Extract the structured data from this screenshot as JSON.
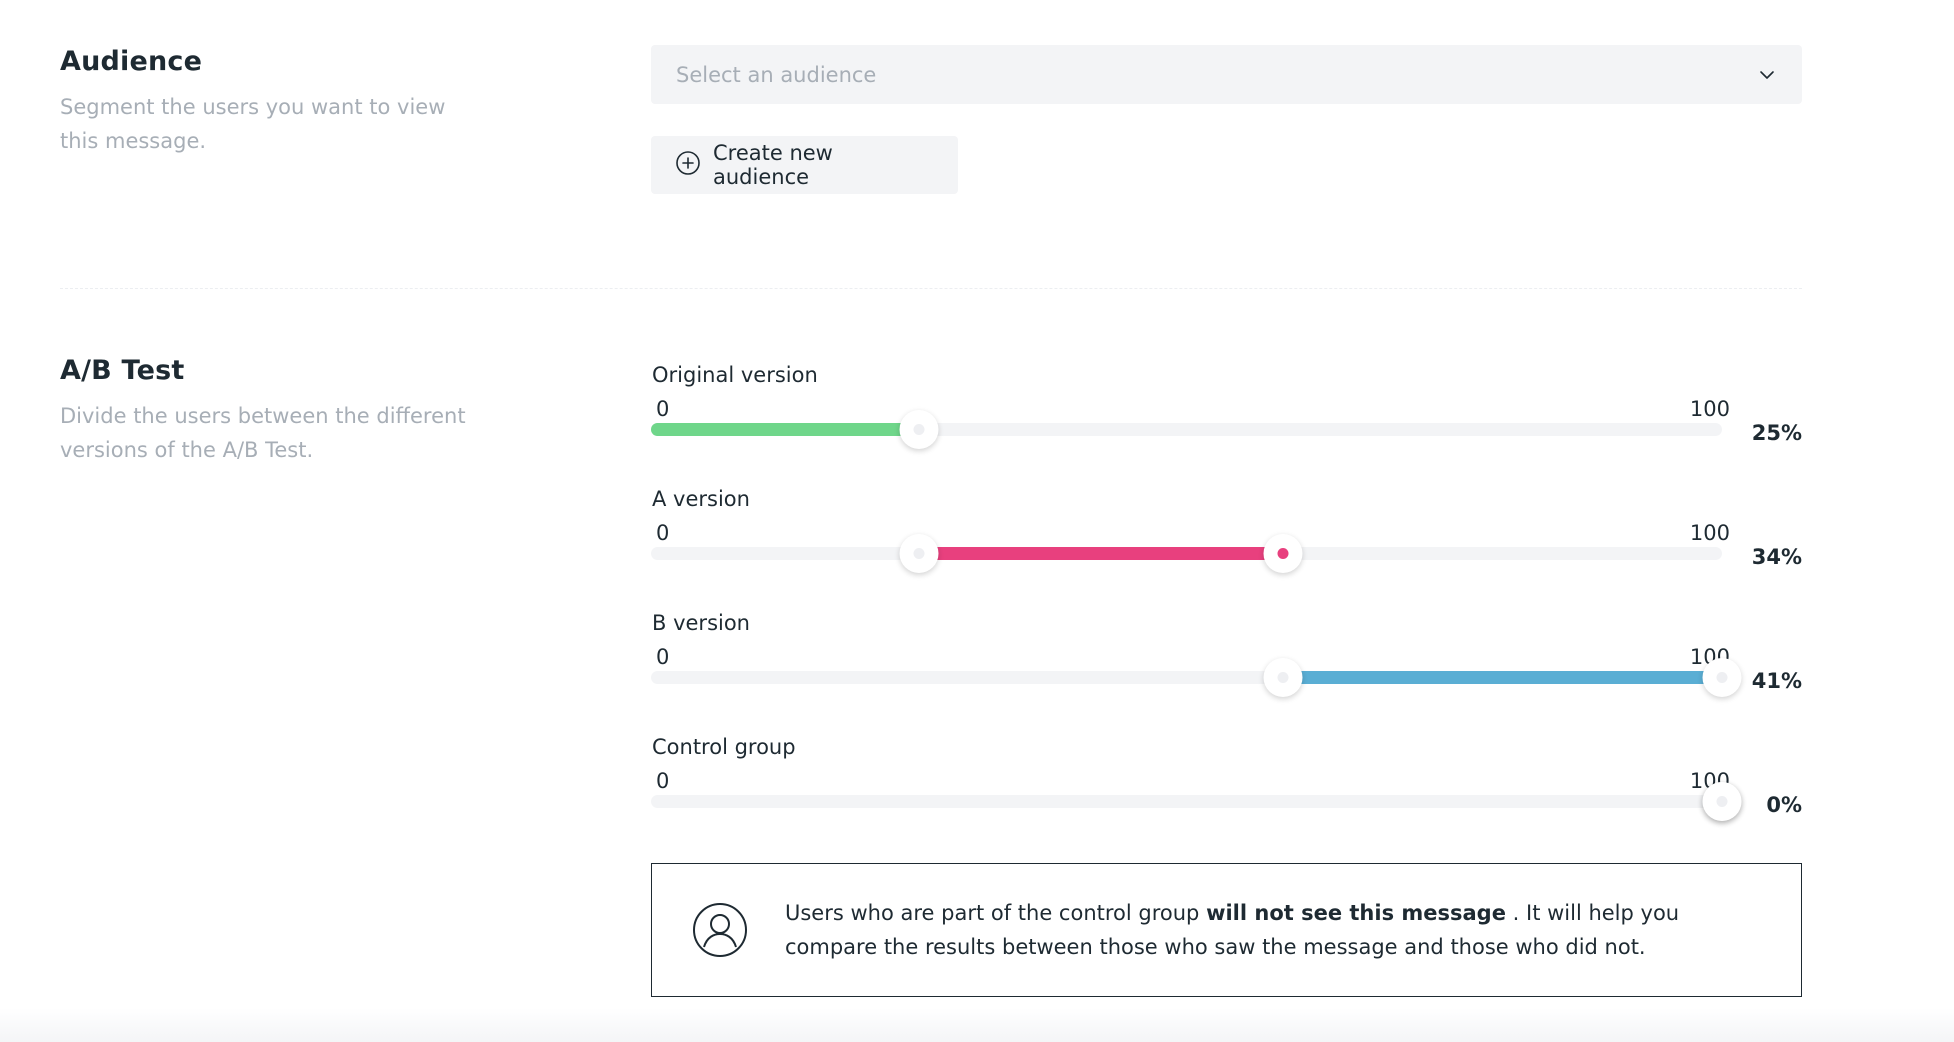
{
  "audience": {
    "title": "Audience",
    "description": "Segment the users you want to view this message.",
    "select_placeholder": "Select an audience",
    "create_button_label": "Create new audience",
    "create_icon": "plus-circle-icon",
    "dropdown_icon": "chevron-down-icon"
  },
  "ab_test": {
    "title": "A/B Test",
    "description": "Divide the users between the different versions of the A/B Test.",
    "min_label": "0",
    "max_label": "100",
    "sliders": [
      {
        "label": "Original version",
        "start": 0,
        "end": 25,
        "percent": "25%",
        "color": "#6fd68a"
      },
      {
        "label": "A version",
        "start": 25,
        "end": 59,
        "percent": "34%",
        "color": "#e8407e"
      },
      {
        "label": "B version",
        "start": 59,
        "end": 100,
        "percent": "41%",
        "color": "#5aaed4"
      },
      {
        "label": "Control group",
        "start": 100,
        "end": 100,
        "percent": "0%",
        "color": "#cfd3d8"
      }
    ]
  },
  "info": {
    "icon": "user-circle-icon",
    "text_before": "Users who are part of the control group ",
    "text_bold": "will not see this message",
    "text_after": " . It will help you compare the results between those who saw the message and those who did not."
  }
}
